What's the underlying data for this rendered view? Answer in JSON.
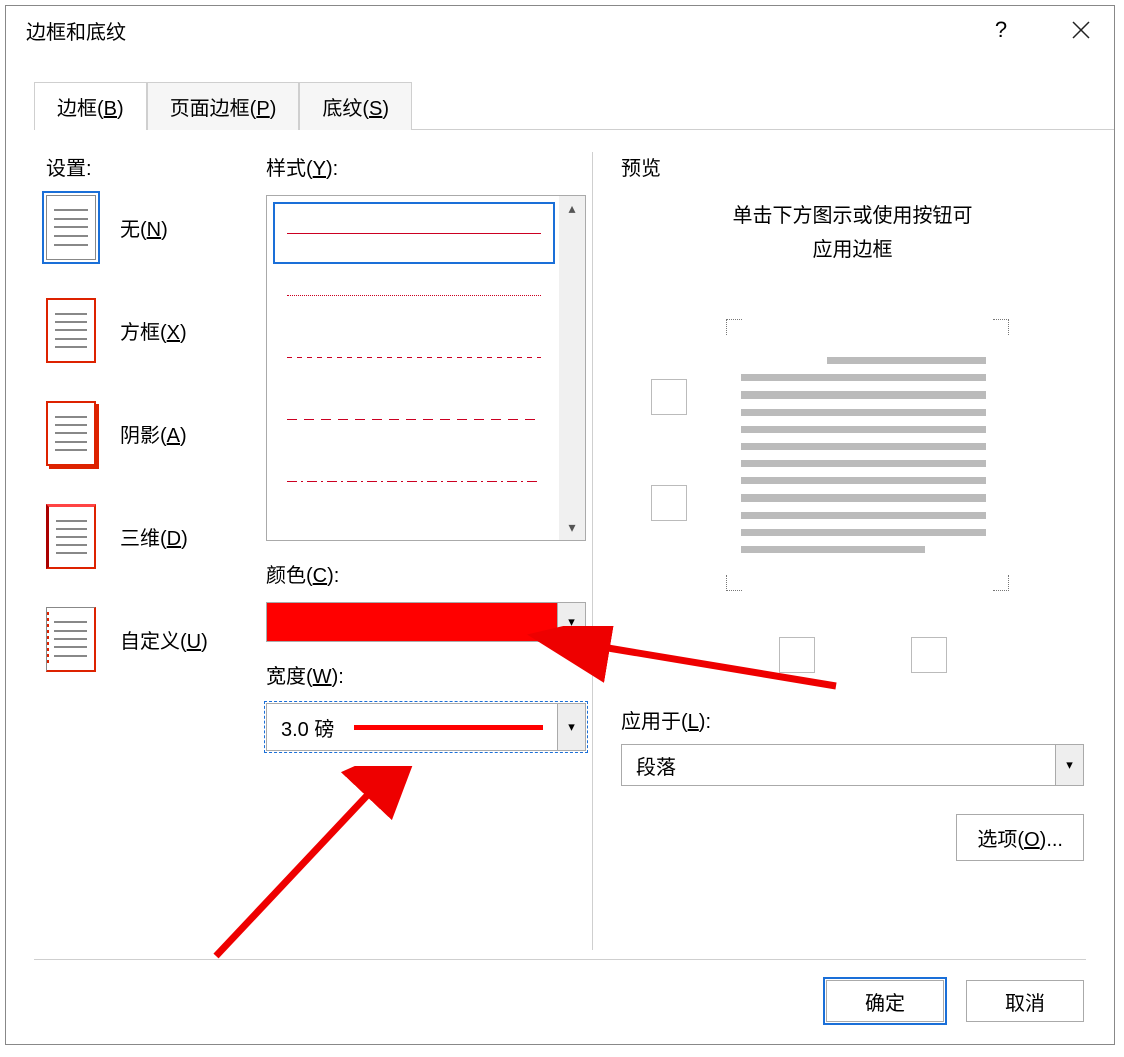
{
  "dialog": {
    "title": "边框和底纹"
  },
  "tabs": {
    "border": "边框(B)",
    "page_border": "页面边框(P)",
    "shading": "底纹(S)"
  },
  "settings": {
    "label": "设置:",
    "none": "无(N)",
    "box": "方框(X)",
    "shadow": "阴影(A)",
    "threed": "三维(D)",
    "custom": "自定义(U)"
  },
  "style": {
    "label": "样式(Y):"
  },
  "color": {
    "label": "颜色(C):",
    "value": "#ff0000"
  },
  "width": {
    "label": "宽度(W):",
    "value": "3.0 磅"
  },
  "preview": {
    "label": "预览",
    "hint1": "单击下方图示或使用按钮可",
    "hint2": "应用边框"
  },
  "apply_to": {
    "label": "应用于(L):",
    "value": "段落"
  },
  "options_btn": "选项(O)...",
  "buttons": {
    "ok": "确定",
    "cancel": "取消"
  }
}
